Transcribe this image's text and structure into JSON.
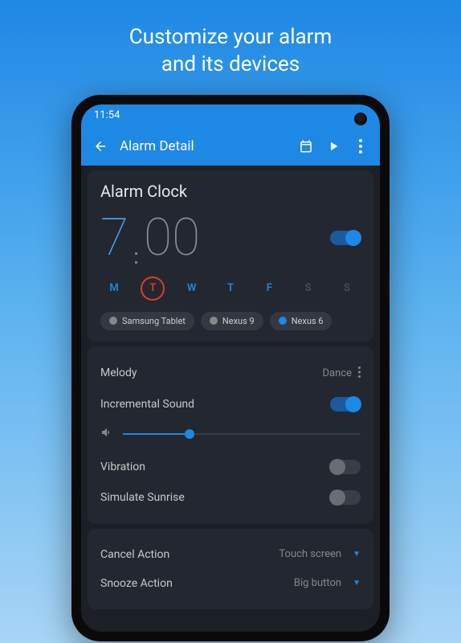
{
  "promo": {
    "line1": "Customize your alarm",
    "line2": "and its devices"
  },
  "statusBar": {
    "time": "11:54"
  },
  "appBar": {
    "title": "Alarm Detail"
  },
  "alarm": {
    "name": "Alarm Clock",
    "hour": "7",
    "minute": "00",
    "enabled": true
  },
  "days": [
    {
      "label": "M",
      "state": "active"
    },
    {
      "label": "T",
      "state": "selected"
    },
    {
      "label": "W",
      "state": "active"
    },
    {
      "label": "T",
      "state": "active"
    },
    {
      "label": "F",
      "state": "active"
    },
    {
      "label": "S",
      "state": "inactive"
    },
    {
      "label": "S",
      "state": "inactive"
    }
  ],
  "devices": [
    {
      "name": "Samsung Tablet",
      "active": false
    },
    {
      "name": "Nexus 9",
      "active": false
    },
    {
      "name": "Nexus 6",
      "active": true
    }
  ],
  "sound": {
    "melodyLabel": "Melody",
    "melodyValue": "Dance",
    "incrementalLabel": "Incremental Sound",
    "incrementalEnabled": true,
    "volumePercent": 28,
    "vibrationLabel": "Vibration",
    "vibrationEnabled": false,
    "sunriseLabel": "Simulate Sunrise",
    "sunriseEnabled": false
  },
  "actions": {
    "cancelLabel": "Cancel Action",
    "cancelValue": "Touch screen",
    "snoozeLabel": "Snooze Action",
    "snoozeValue": "Big button"
  }
}
